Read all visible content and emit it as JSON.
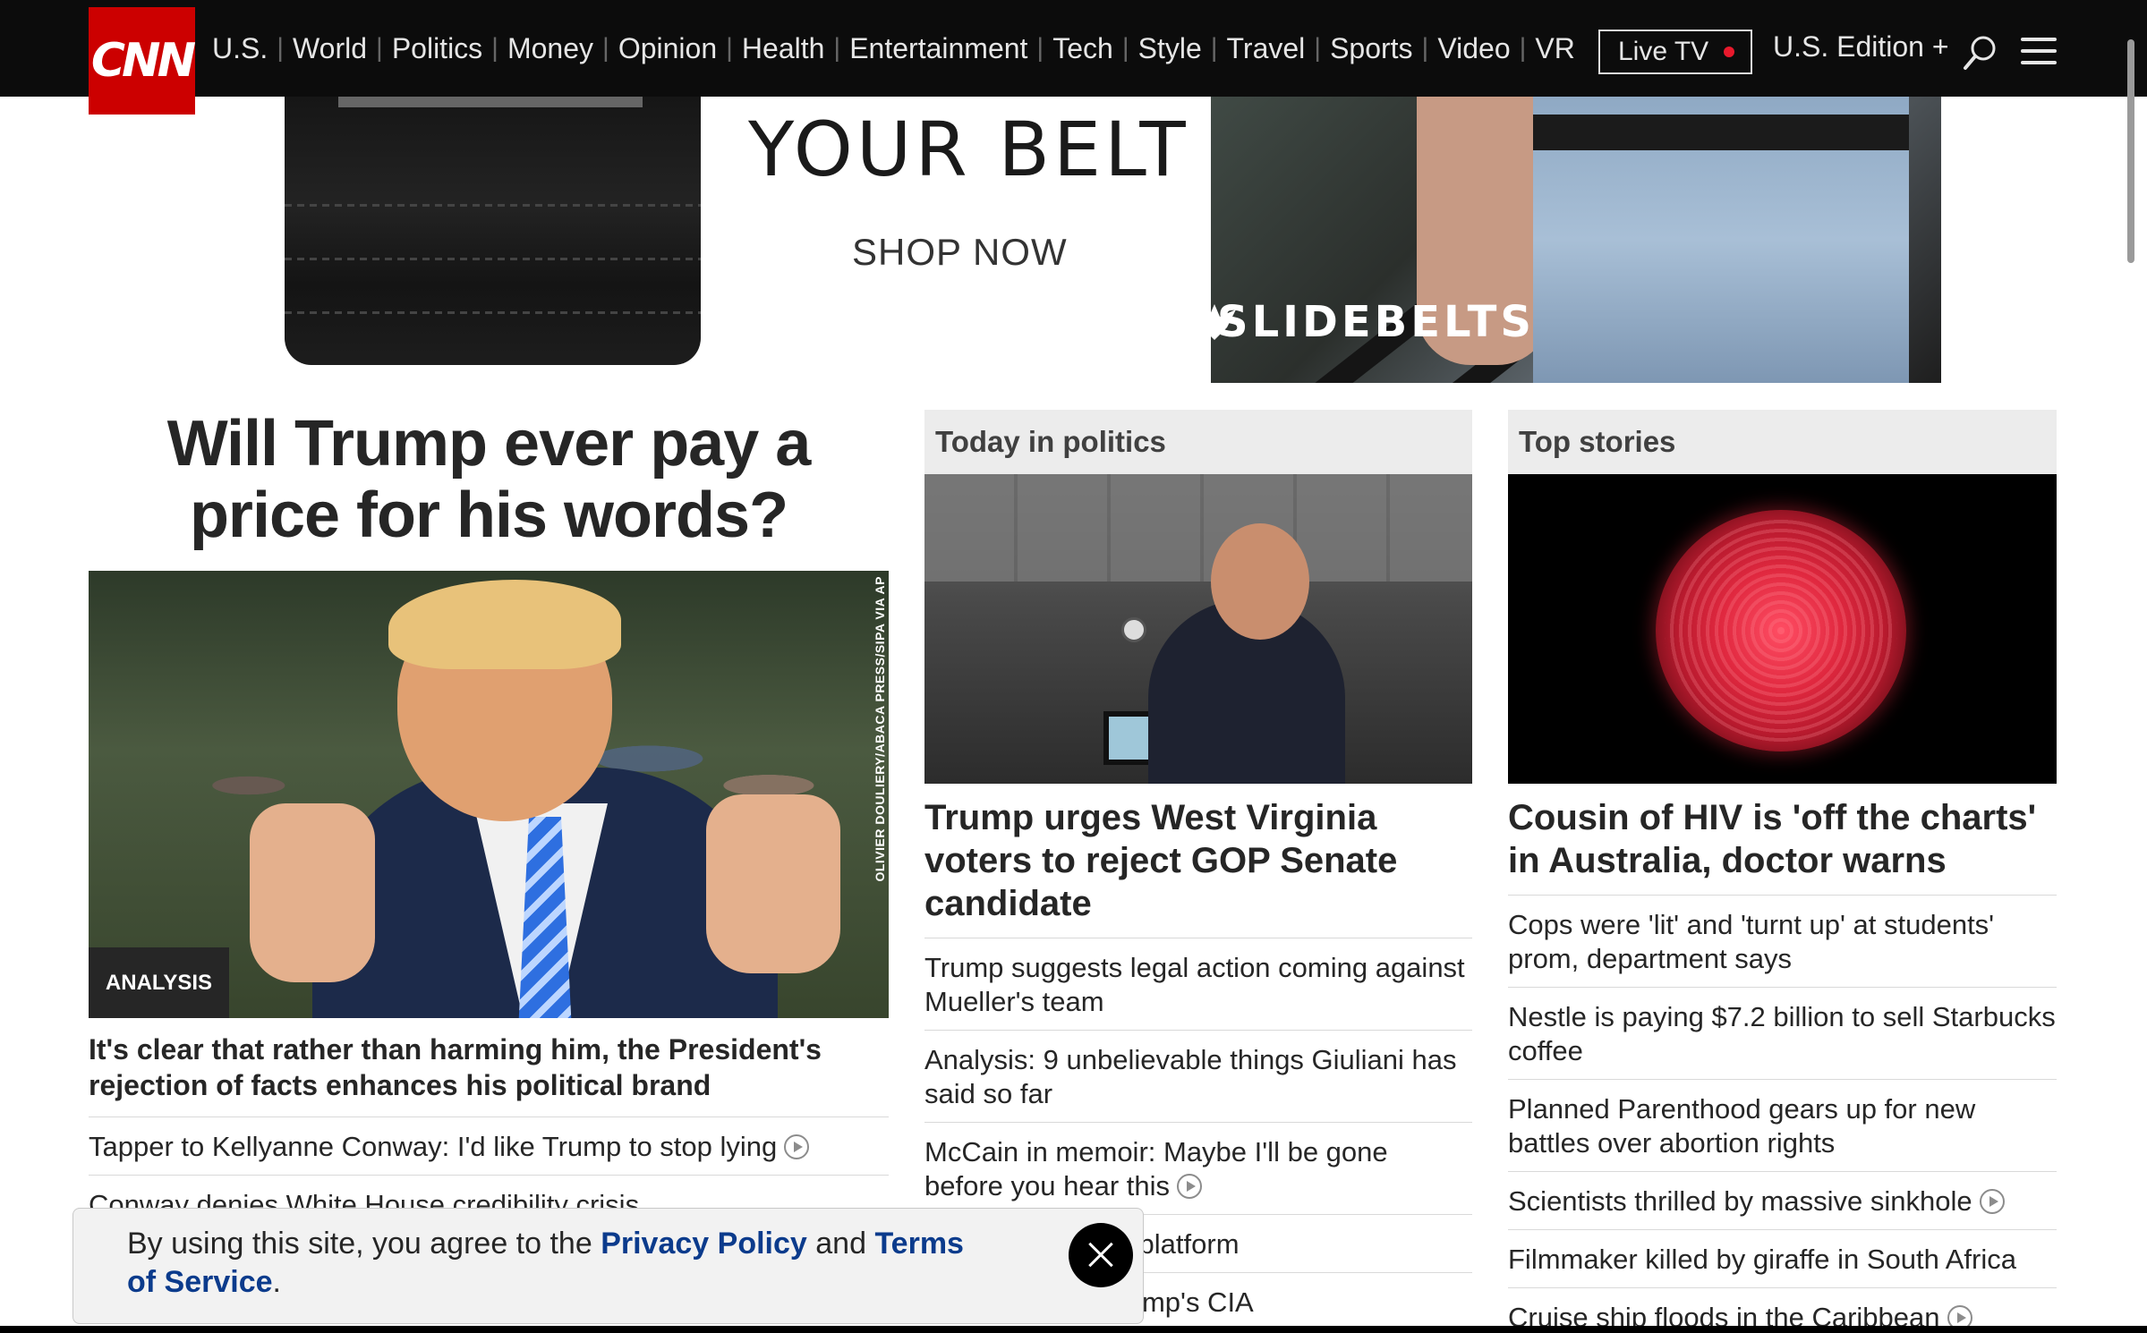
{
  "nav": {
    "logo_text": "CNN",
    "links": [
      "U.S.",
      "World",
      "Politics",
      "Money",
      "Opinion",
      "Health",
      "Entertainment",
      "Tech",
      "Style",
      "Travel",
      "Sports",
      "Video",
      "VR"
    ],
    "live_tv": "Live TV",
    "edition": "U.S. Edition +",
    "icons": [
      "search-icon",
      "menu-icon"
    ]
  },
  "ad": {
    "headline": "YOUR BELT",
    "cta": "SHOP NOW",
    "brand": "SLIDEBELTS"
  },
  "lead": {
    "headline": "Will Trump ever pay a price for his words?",
    "photo_credit": "OLIVIER DOULIERY/ABACA PRESS/SIPA VIA AP",
    "tag": "ANALYSIS",
    "subhead": "It's clear that rather than harming him, the President's rejection of facts enhances his political brand",
    "stories": [
      {
        "text": "Tapper to Kellyanne Conway: I'd like Trump to stop lying",
        "video": true
      },
      {
        "text": "Conway denies White House credibility crisis",
        "video": false
      }
    ]
  },
  "politics": {
    "title": "Today in politics",
    "headline": "Trump urges West Virginia voters to reject GOP Senate candidate",
    "stories": [
      {
        "text": "Trump suggests legal action coming against Mueller's team",
        "video": false
      },
      {
        "text": "Analysis: 9 unbelievable things Giuliani has said so far",
        "video": false
      },
      {
        "text": "McCain in memoir: Maybe I'll be gone before you hear this",
        "video": true
      },
      {
        "text": "announce formal platform",
        "video": false
      },
      {
        "text": "ackup plans if Trump's CIA",
        "video": false
      }
    ]
  },
  "top": {
    "title": "Top stories",
    "headline": "Cousin of HIV is 'off the charts' in Australia, doctor warns",
    "stories": [
      {
        "text": "Cops were 'lit' and 'turnt up' at students' prom, department says",
        "video": false
      },
      {
        "text": "Nestle is paying $7.2 billion to sell Starbucks coffee",
        "video": false
      },
      {
        "text": "Planned Parenthood gears up for new battles over abortion rights",
        "video": false
      },
      {
        "text": "Scientists thrilled by massive sinkhole",
        "video": true
      },
      {
        "text": "Filmmaker killed by giraffe in South Africa",
        "video": false
      },
      {
        "text": "Cruise ship floods in the Caribbean",
        "video": true
      }
    ]
  },
  "cookie": {
    "prefix": "By using this site, you agree to the ",
    "privacy": "Privacy Policy",
    "and": " and ",
    "terms": "Terms of Service",
    "suffix": "."
  },
  "colors": {
    "brand_red": "#cc0000",
    "nav_bg": "#0c0c0c",
    "link_blue": "#0b3b8c",
    "live_dot": "#e8192c"
  }
}
